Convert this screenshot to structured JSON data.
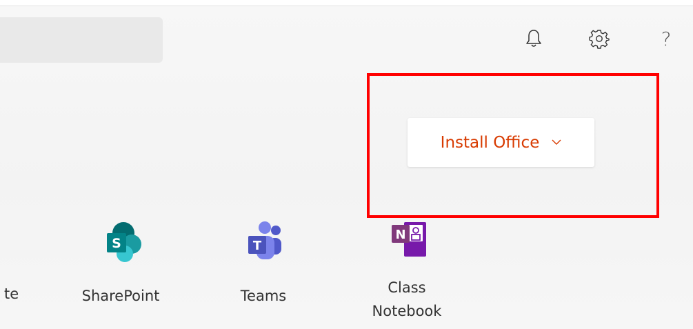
{
  "header": {
    "search_value": "",
    "icons": [
      "bell-icon",
      "gear-icon",
      "help-icon"
    ],
    "help_glyph": "?"
  },
  "install_office": {
    "label": "Install Office",
    "chevron": "chevron-down-icon",
    "color": "#d83b01"
  },
  "highlight": {
    "color": "#ff0000"
  },
  "apps": {
    "partial_label": "te",
    "items": [
      {
        "label": "SharePoint",
        "icon": "sharepoint-icon"
      },
      {
        "label": "Teams",
        "icon": "teams-icon"
      },
      {
        "label_line1": "Class",
        "label_line2": "Notebook",
        "icon": "class-notebook-icon"
      }
    ]
  }
}
